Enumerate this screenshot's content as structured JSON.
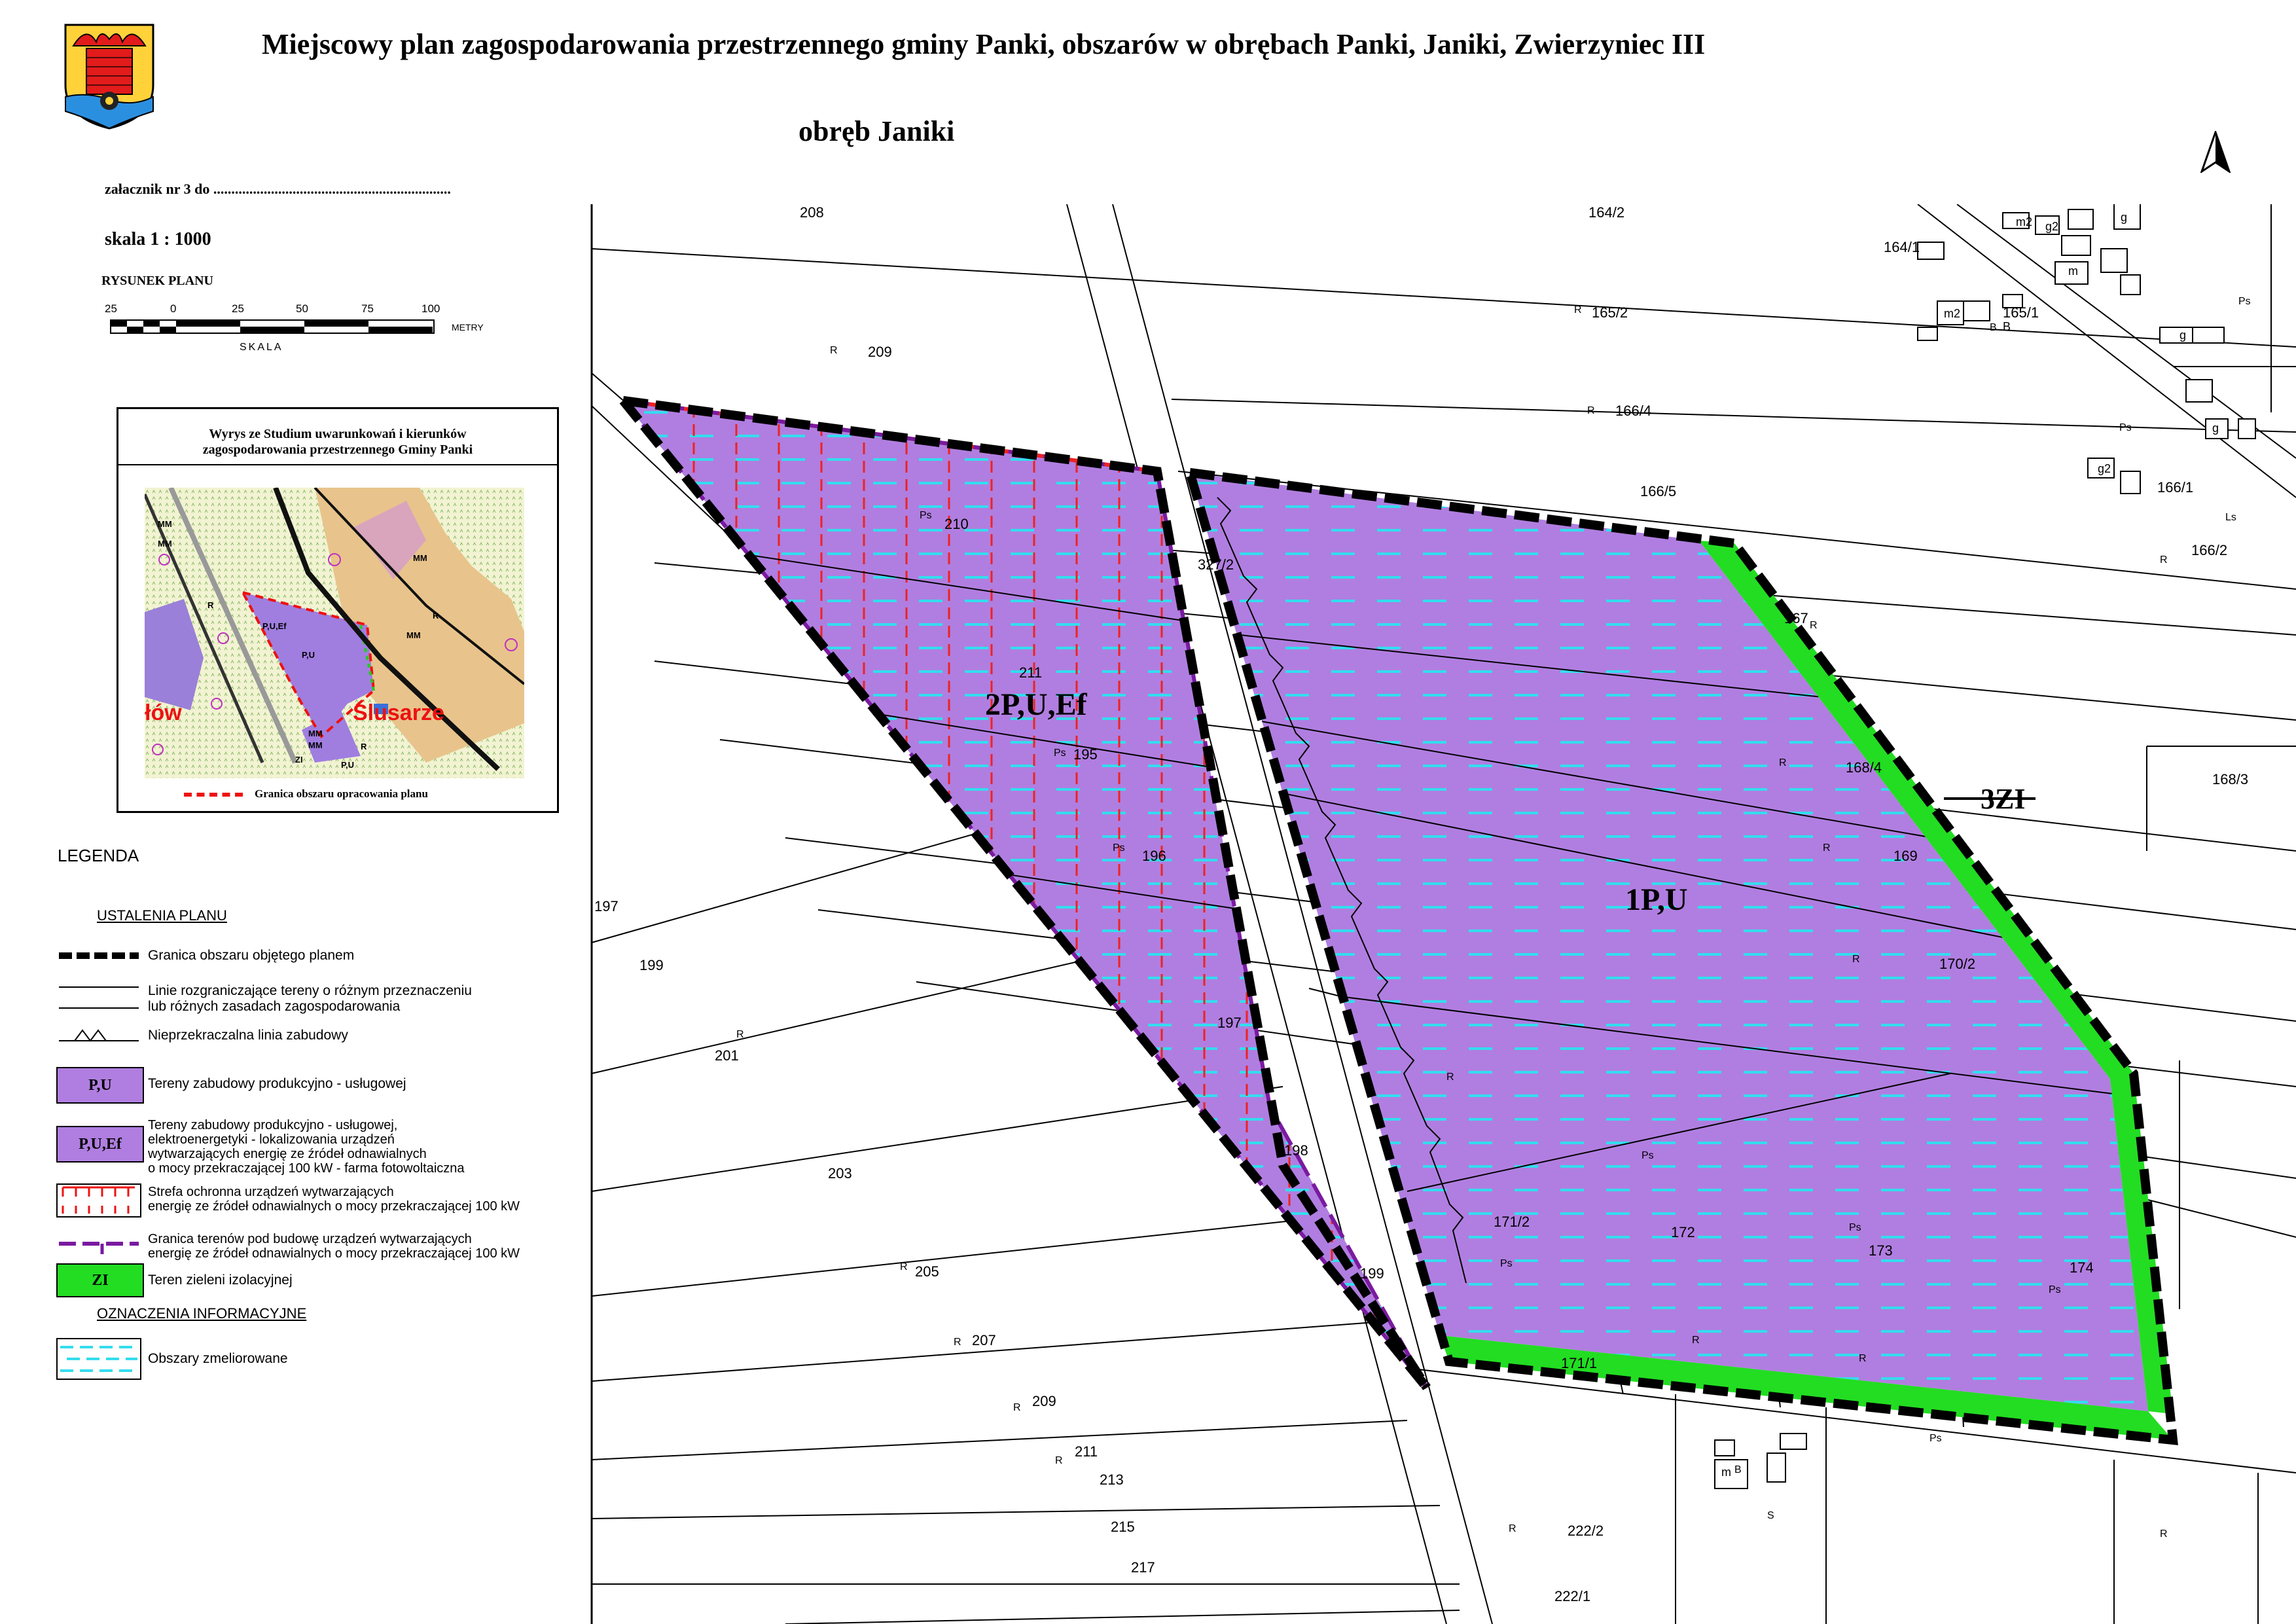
{
  "header": {
    "title": "Miejscowy plan zagospodarowania przestrzennego gminy Panki, obszarów w obrębach  Panki, Janiki, Zwierzyniec III",
    "subtitle": "obręb Janiki",
    "annex": "załacznik nr 3 do ..................................................................",
    "scale": "skala 1 : 1000",
    "drawing_label": "RYSUNEK  PLANU"
  },
  "scalebar": {
    "ticks": [
      "25",
      "0",
      "25",
      "50",
      "75",
      "100"
    ],
    "units": "METRY",
    "word": "SKALA"
  },
  "inset": {
    "title_line1": "Wyrys ze Studium uwarunkowań i kierunków",
    "title_line2": "zagospodarowania przestrzennego Gminy Panki",
    "legend": "Granica obszaru opracowania planu",
    "place": "Ślusarze",
    "place_partial": "łów",
    "labels": [
      "MM",
      "MM",
      "R",
      "P,U,Ef",
      "P,U",
      "MM",
      "MM",
      "R",
      "ZI",
      "P,U",
      "MM",
      "MM",
      "R"
    ]
  },
  "legend": {
    "heading": "LEGENDA",
    "section1": "USTALENIA PLANU",
    "section2": "OZNACZENIA INFORMACYJNE",
    "items": {
      "boundary": "Granica obszaru objętego planem",
      "lines_1": "Linie rozgraniczające tereny o różnym przeznaczeniu",
      "lines_2": "lub różnych zasadach zagospodarowania",
      "building_line": "Nieprzekraczalna linia zabudowy",
      "pu_code": "P,U",
      "pu": "Tereny zabudowy produkcyjno - usługowej",
      "puef_code": "P,U,Ef",
      "puef_1": "Tereny zabudowy produkcyjno - usługowej,",
      "puef_2": "elektroenergetyki - lokalizowania urządzeń",
      "puef_3": "wytwarzających energię ze źródeł odnawialnych",
      "puef_4": "o mocy przekraczającej 100 kW - farma fotowoltaiczna",
      "zone_1": "Strefa ochronna urządzeń wytwarzających",
      "zone_2": "energię ze źródeł odnawialnych o mocy przekraczającej 100 kW",
      "border_1": "Granica terenów pod budowę urządzeń wytwarzających",
      "border_2": "energię ze źródeł odnawialnych o mocy przekraczającej 100 kW",
      "zi_code": "ZI",
      "zi": "Teren zieleni izolacyjnej",
      "drained": "Obszary zmeliorowane"
    }
  },
  "map": {
    "zones": {
      "z1": "1P,U",
      "z2": "2P,U,Ef",
      "z3": "3ZI"
    },
    "parcels": [
      "208",
      "164/2",
      "209",
      "165/2",
      "166/4",
      "166/5",
      "164/1",
      "165/1",
      "210",
      "327/2",
      "167",
      "166/1",
      "166/2",
      "211",
      "195",
      "168/4",
      "168/3",
      "196",
      "169",
      "170/2",
      "197",
      "199",
      "197",
      "201",
      "198",
      "203",
      "171/2",
      "172",
      "173",
      "174",
      "199",
      "205",
      "207",
      "209",
      "171/1",
      "211",
      "213",
      "215",
      "217",
      "222/2",
      "222/1"
    ],
    "land_codes": [
      "R",
      "Ps",
      "B",
      "Ls",
      "S"
    ],
    "buildings": [
      "m2",
      "g2",
      "g",
      "m",
      "m2",
      "B",
      "g",
      "g",
      "g2",
      "m"
    ]
  },
  "colors": {
    "zone_pu": "#b07ee0",
    "zone_zi": "#22dd22",
    "drained": "#33ddee",
    "protection": "#ee2222",
    "border": "#7a1aa0"
  },
  "icons": [
    "coat-of-arms-icon",
    "north-arrow-icon"
  ]
}
